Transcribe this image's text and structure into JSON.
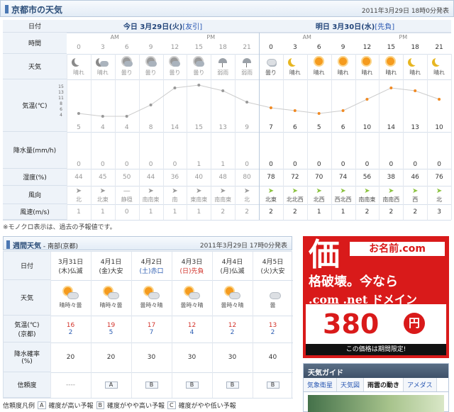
{
  "header": {
    "title": "京都市の天気",
    "issued": "2011年3月29日 18時0分発表"
  },
  "labels": {
    "date": "日付",
    "time": "時間",
    "weather": "天気",
    "temp": "気温(℃)",
    "precip": "降水量(mm/h)",
    "humidity": "湿度(%)",
    "wind_dir": "風向",
    "wind_speed": "風速(m/s)"
  },
  "today": {
    "title": "今日 3月29日(火)",
    "link": "[友引]",
    "am": "AM",
    "pm": "PM"
  },
  "tomorrow": {
    "title": "明日 3月30日(水)",
    "link": "[先負]",
    "am": "AM",
    "pm": "PM"
  },
  "hours": [
    "0",
    "3",
    "6",
    "9",
    "12",
    "15",
    "18",
    "21",
    "0",
    "3",
    "6",
    "9",
    "12",
    "15",
    "18",
    "21"
  ],
  "weather_names": [
    "晴れ",
    "晴れ",
    "曇り",
    "曇り",
    "曇り",
    "曇り",
    "弱雨",
    "弱雨",
    "曇り",
    "晴れ",
    "晴れ",
    "晴れ",
    "晴れ",
    "晴れ",
    "晴れ",
    "晴れ"
  ],
  "weather_icons": [
    "moon",
    "moon-cloud",
    "sun-cloud",
    "sun-cloud",
    "sun-cloud",
    "sun-cloud",
    "rain",
    "rain",
    "cloud",
    "moon",
    "sun",
    "sun",
    "sun",
    "sun",
    "moon",
    "moon"
  ],
  "temp_axis": [
    "15",
    "13",
    "11",
    "8",
    "6",
    "4"
  ],
  "temps": [
    "5",
    "4",
    "4",
    "8",
    "14",
    "15",
    "13",
    "9",
    "7",
    "6",
    "5",
    "6",
    "10",
    "14",
    "13",
    "10"
  ],
  "precip": [
    "0",
    "0",
    "0",
    "0",
    "0",
    "1",
    "1",
    "0",
    "0",
    "0",
    "0",
    "0",
    "0",
    "0",
    "0",
    "0"
  ],
  "humidity": [
    "44",
    "45",
    "50",
    "44",
    "36",
    "40",
    "48",
    "80",
    "78",
    "72",
    "70",
    "74",
    "56",
    "38",
    "46",
    "76"
  ],
  "wind_dir": [
    "北",
    "北東",
    "静穏",
    "南南東",
    "南",
    "東南東",
    "南南東",
    "北",
    "北東",
    "北北西",
    "北西",
    "西北西",
    "南南東",
    "南南西",
    "西",
    "北"
  ],
  "wind_speed": [
    "1",
    "1",
    "0",
    "1",
    "1",
    "1",
    "2",
    "2",
    "2",
    "2",
    "1",
    "1",
    "2",
    "2",
    "2",
    "3"
  ],
  "note": "※モノクロ表示は、過去の予報値です。",
  "weekly": {
    "title": "週間天気",
    "region": " - 南部(京都)",
    "issued": "2011年3月29日 17時0分発表",
    "labels": {
      "date": "日付",
      "weather": "天気",
      "temp": "気温(℃)",
      "temp2": "(京都)",
      "precip": "降水確率",
      "precip2": "(%)",
      "reliability": "信頼度"
    },
    "days": [
      {
        "date": "3月31日",
        "dow": "(木)仏滅",
        "weather": "晴時々曇",
        "hi": "16",
        "lo": "2",
        "pop": "20",
        "rel": "----"
      },
      {
        "date": "4月1日",
        "dow": "(金)大安",
        "weather": "晴時々曇",
        "hi": "19",
        "lo": "5",
        "pop": "20",
        "rel": "A"
      },
      {
        "date": "4月2日",
        "dow": "(土)赤口",
        "weather": "曇時々晴",
        "hi": "17",
        "lo": "7",
        "pop": "30",
        "rel": "B"
      },
      {
        "date": "4月3日",
        "dow": "(日)先負",
        "weather": "曇時々晴",
        "hi": "12",
        "lo": "4",
        "pop": "30",
        "rel": "B"
      },
      {
        "date": "4月4日",
        "dow": "(月)仏滅",
        "weather": "曇時々晴",
        "hi": "12",
        "lo": "2",
        "pop": "30",
        "rel": "B"
      },
      {
        "date": "4月5日",
        "dow": "(火)大安",
        "weather": "曇",
        "hi": "13",
        "lo": "2",
        "pop": "40",
        "rel": "B"
      }
    ],
    "legend": {
      "title": "信頼度凡例",
      "a": "A",
      "a_text": "確度が高い予報",
      "b": "B",
      "b_text": "確度がやや高い予報",
      "c": "C",
      "c_text": "確度がやや低い予報"
    }
  },
  "ad": {
    "line1": "価",
    "line2": "格破壊。今なら",
    "domains": ".com .net ドメイン",
    "price": "380",
    "yen": "円",
    "footer": "この価格は期間限定!",
    "brand": "お名前.com"
  },
  "guide": {
    "title": "天気ガイド",
    "tabs": [
      "気象衛星",
      "天気図",
      "雨雲の動き",
      "アメダス"
    ]
  },
  "colors": {
    "past": "#999999",
    "future": "#f08a24",
    "accent": "#2d4f7a"
  }
}
